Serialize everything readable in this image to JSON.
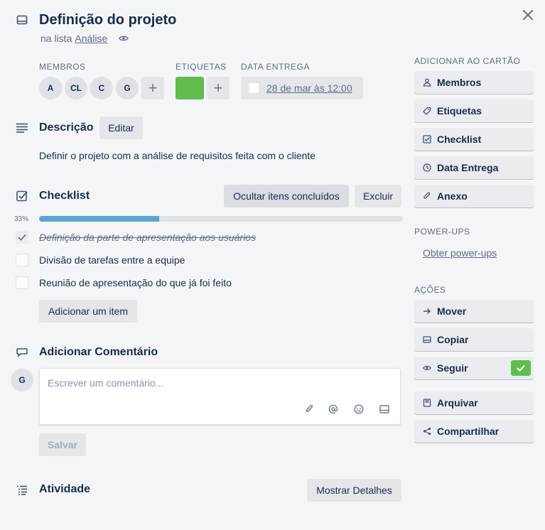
{
  "card": {
    "title": "Definição do projeto",
    "in_list_prefix": "na lista",
    "list_name": "Análise"
  },
  "members": {
    "label": "MEMBROS",
    "avatars": [
      "A",
      "CL",
      "C",
      "G"
    ],
    "add": "+"
  },
  "labels": {
    "label": "ETIQUETAS",
    "colors": [
      "#61bd4f"
    ],
    "add": "+"
  },
  "due": {
    "label": "DATA ENTREGA",
    "value": "28 de mar às 12:00"
  },
  "description": {
    "heading": "Descrição",
    "edit_label": "Editar",
    "text": "Definir o projeto com a análise de requisitos feita com o cliente"
  },
  "checklist": {
    "heading": "Checklist",
    "hide_done_label": "Ocultar itens concluídos",
    "delete_label": "Excluir",
    "progress_text": "33%",
    "progress": 0.33,
    "items": [
      {
        "text": "Definição da parte de apresentação aos usuários",
        "done": true
      },
      {
        "text": "Divisão de tarefas entre a equipe",
        "done": false
      },
      {
        "text": "Reunião de apresentação do que já foi feito",
        "done": false
      }
    ],
    "add_item_label": "Adicionar um item"
  },
  "comment": {
    "heading": "Adicionar Comentário",
    "avatar": "G",
    "placeholder": "Escrever um comentário...",
    "save_label": "Salvar"
  },
  "activity": {
    "heading": "Atividade",
    "show_details_label": "Mostrar Detalhes"
  },
  "sidebar": {
    "add_to_card_label": "ADICIONAR AO CARTÃO",
    "add_buttons": [
      "Membros",
      "Etiquetas",
      "Checklist",
      "Data Entrega",
      "Anexo"
    ],
    "powerups_label": "POWER-UPS",
    "powerups_link": "Obter power-ups",
    "actions_label": "AÇÕES",
    "actions": [
      "Mover",
      "Copiar",
      "Seguir",
      "Arquivar",
      "Compartilhar"
    ]
  },
  "colors": {
    "accent_green": "#61bd4f",
    "progress_blue": "#5ba4cf"
  }
}
